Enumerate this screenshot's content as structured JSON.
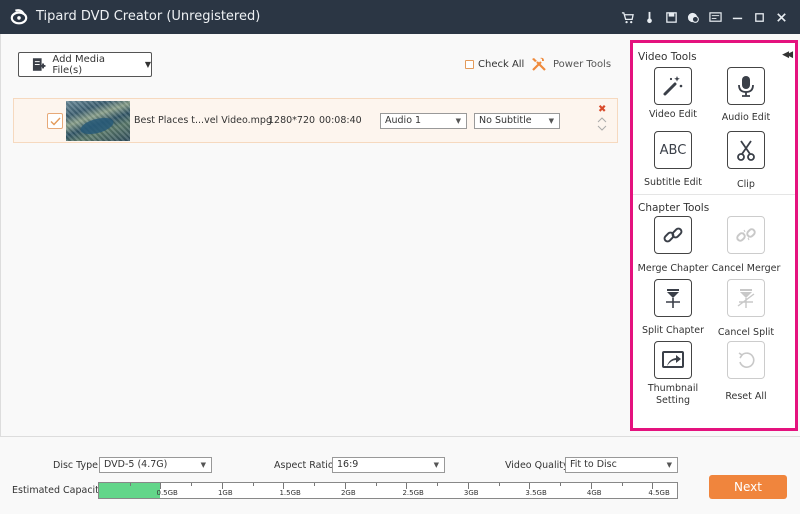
{
  "window": {
    "title": "Tipard DVD Creator (Unregistered)",
    "titlebar_icons": [
      "cart-icon",
      "key-icon",
      "register-icon",
      "feedback-icon",
      "menu-icon",
      "minimize-icon",
      "maximize-icon",
      "close-icon"
    ]
  },
  "toolbar": {
    "add_media_label": "Add Media File(s)",
    "check_all_label": "Check All",
    "power_tools_label": "Power Tools"
  },
  "files": [
    {
      "checked": true,
      "name": "Best Places t...vel Video.mpg",
      "resolution": "1280*720",
      "duration": "00:08:40",
      "audio": "Audio 1",
      "subtitle": "No Subtitle"
    }
  ],
  "tools": {
    "video_tools_title": "Video Tools",
    "video_tools": [
      {
        "label": "Video Edit",
        "icon": "magic-wand-icon",
        "enabled": true
      },
      {
        "label": "Audio Edit",
        "icon": "microphone-icon",
        "enabled": true
      },
      {
        "label": "Subtitle Edit",
        "icon": "abc-icon",
        "icon_text": "ABC",
        "enabled": true
      },
      {
        "label": "Clip",
        "icon": "scissors-icon",
        "enabled": true
      }
    ],
    "chapter_tools_title": "Chapter Tools",
    "chapter_tools": [
      {
        "label": "Merge Chapter",
        "icon": "link-icon",
        "enabled": true
      },
      {
        "label": "Cancel Merger",
        "icon": "broken-link-icon",
        "enabled": false
      },
      {
        "label": "Split Chapter",
        "icon": "split-icon",
        "enabled": true
      },
      {
        "label": "Cancel Split",
        "icon": "cancel-split-icon",
        "enabled": false
      },
      {
        "label": "Thumbnail Setting",
        "label_line1": "Thumbnail",
        "label_line2": "Setting",
        "icon": "thumbnail-icon",
        "enabled": true
      },
      {
        "label": "Reset All",
        "icon": "reset-icon",
        "enabled": false
      }
    ]
  },
  "bottom": {
    "disc_type_label": "Disc Type",
    "disc_type_value": "DVD-5 (4.7G)",
    "aspect_ratio_label": "Aspect Ratio:",
    "aspect_ratio_value": "16:9",
    "video_quality_label": "Video Quality:",
    "video_quality_value": "Fit to Disc",
    "capacity_label": "Estimated Capacity:",
    "capacity_used_gb": 0.5,
    "capacity_max_gb": 4.7,
    "capacity_ticks": [
      "0.5GB",
      "1GB",
      "1.5GB",
      "2GB",
      "2.5GB",
      "3GB",
      "3.5GB",
      "4GB",
      "4.5GB"
    ],
    "next_label": "Next"
  },
  "colors": {
    "accent": "#f0853d",
    "titlebar": "#2b3644",
    "highlight_border": "#e4127e",
    "capacity_fill": "#63d68a"
  }
}
